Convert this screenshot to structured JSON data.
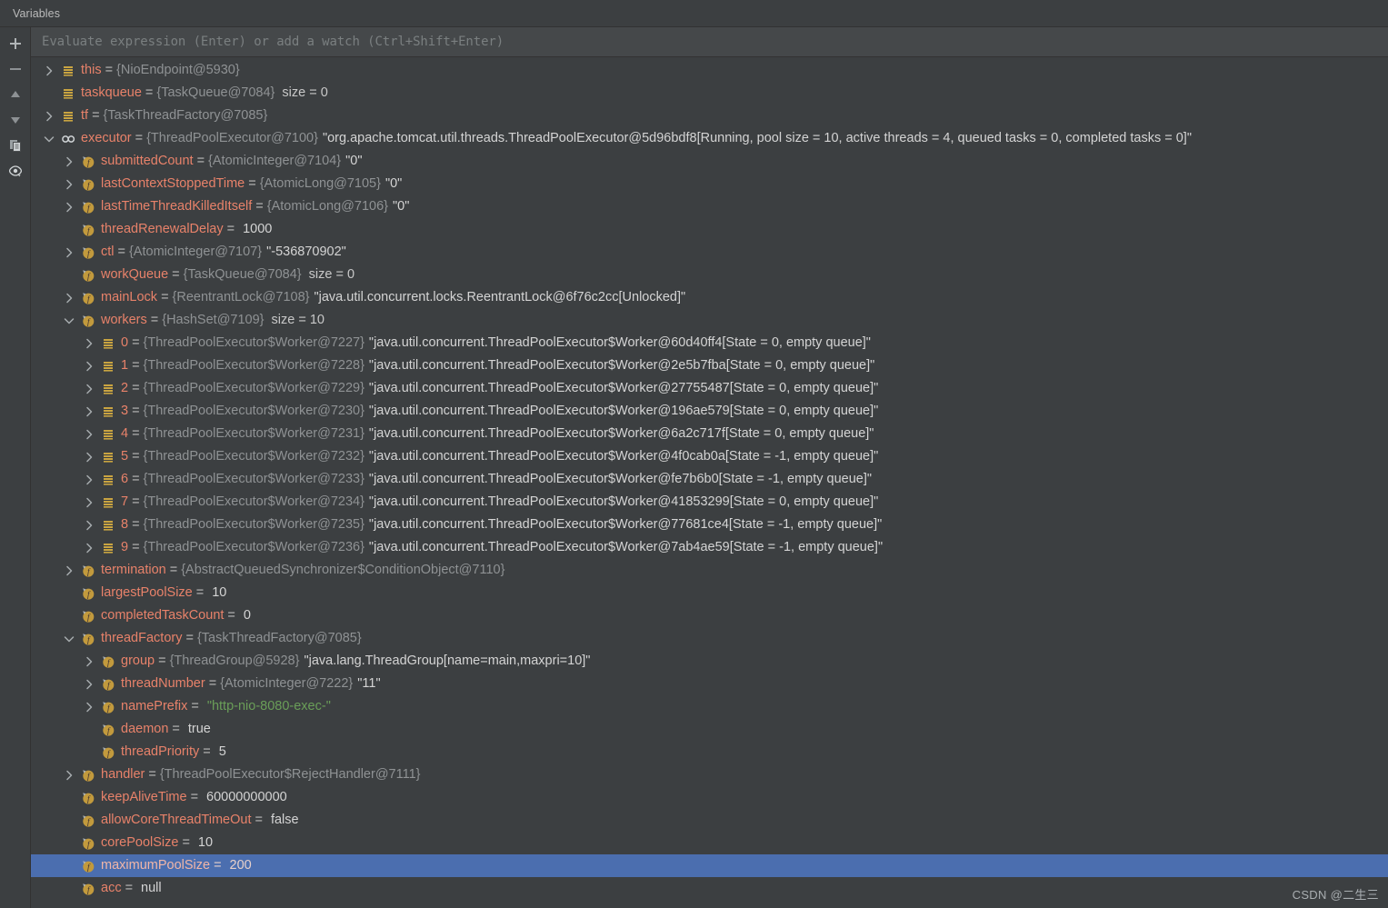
{
  "window": {
    "tab_label": "Variables"
  },
  "toolbar": {
    "buttons": [
      {
        "name": "add-watch-button",
        "icon": "plus-icon",
        "tooltip": "Add"
      },
      {
        "name": "remove-watch-button",
        "icon": "minus-icon",
        "tooltip": "Remove"
      },
      {
        "name": "move-up-button",
        "icon": "arrow-up-icon",
        "tooltip": "Up"
      },
      {
        "name": "move-down-button",
        "icon": "arrow-down-icon",
        "tooltip": "Down"
      },
      {
        "name": "copy-button",
        "icon": "copy-icon",
        "tooltip": "Copy"
      },
      {
        "name": "view-options-button",
        "icon": "eye-icon",
        "tooltip": "View Options"
      }
    ]
  },
  "evaluate": {
    "placeholder": "Evaluate expression (Enter) or add a watch (Ctrl+Shift+Enter)",
    "value": ""
  },
  "colors": {
    "background": "#3c3f41",
    "eval_background": "#45484a",
    "selection": "#4b6eaf",
    "name": "#e8826a",
    "type": "#8f9294",
    "value": "#d4d4d4",
    "string_literal": "#6a9e58",
    "icon_orange": "#c9a441"
  },
  "watermark": "CSDN @二生三",
  "tree": {
    "rows": [
      {
        "indent": 0,
        "twisty": "collapsed",
        "icon": "local-variable-icon",
        "name": "this",
        "eq": "=",
        "type": "{NioEndpoint@5930}",
        "value": "",
        "extra": ""
      },
      {
        "indent": 0,
        "twisty": "none",
        "icon": "local-variable-icon",
        "name": "taskqueue",
        "eq": "=",
        "type": "{TaskQueue@7084}",
        "value": "",
        "extra": "size = 0"
      },
      {
        "indent": 0,
        "twisty": "collapsed",
        "icon": "local-variable-icon",
        "name": "tf",
        "eq": "=",
        "type": "{TaskThreadFactory@7085}",
        "value": "",
        "extra": ""
      },
      {
        "indent": 0,
        "twisty": "expanded",
        "icon": "watch-icon",
        "name": "executor",
        "eq": "=",
        "type": "{ThreadPoolExecutor@7100}",
        "value": "\"org.apache.tomcat.util.threads.ThreadPoolExecutor@5d96bdf8[Running, pool size = 10, active threads = 4, queued tasks = 0, completed tasks = 0]\"",
        "extra": ""
      },
      {
        "indent": 1,
        "twisty": "collapsed",
        "icon": "field-icon",
        "name": "submittedCount",
        "eq": "=",
        "type": "{AtomicInteger@7104}",
        "value": "\"0\"",
        "extra": ""
      },
      {
        "indent": 1,
        "twisty": "collapsed",
        "icon": "field-icon",
        "name": "lastContextStoppedTime",
        "eq": "=",
        "type": "{AtomicLong@7105}",
        "value": "\"0\"",
        "extra": ""
      },
      {
        "indent": 1,
        "twisty": "collapsed",
        "icon": "field-icon",
        "name": "lastTimeThreadKilledItself",
        "eq": "=",
        "type": "{AtomicLong@7106}",
        "value": "\"0\"",
        "extra": ""
      },
      {
        "indent": 1,
        "twisty": "none",
        "icon": "field-icon",
        "name": "threadRenewalDelay",
        "eq": "=",
        "type": "",
        "value": "1000",
        "extra": ""
      },
      {
        "indent": 1,
        "twisty": "collapsed",
        "icon": "field-icon",
        "name": "ctl",
        "eq": "=",
        "type": "{AtomicInteger@7107}",
        "value": "\"-536870902\"",
        "extra": ""
      },
      {
        "indent": 1,
        "twisty": "none",
        "icon": "field-icon",
        "name": "workQueue",
        "eq": "=",
        "type": "{TaskQueue@7084}",
        "value": "",
        "extra": "size = 0"
      },
      {
        "indent": 1,
        "twisty": "collapsed",
        "icon": "field-icon",
        "name": "mainLock",
        "eq": "=",
        "type": "{ReentrantLock@7108}",
        "value": "\"java.util.concurrent.locks.ReentrantLock@6f76c2cc[Unlocked]\"",
        "extra": ""
      },
      {
        "indent": 1,
        "twisty": "expanded",
        "icon": "field-icon",
        "name": "workers",
        "eq": "=",
        "type": "{HashSet@7109}",
        "value": "",
        "extra": "size = 10"
      },
      {
        "indent": 2,
        "twisty": "collapsed",
        "icon": "local-variable-icon",
        "name": "0",
        "eq": "=",
        "type": "{ThreadPoolExecutor$Worker@7227}",
        "value": "\"java.util.concurrent.ThreadPoolExecutor$Worker@60d40ff4[State = 0, empty queue]\"",
        "extra": ""
      },
      {
        "indent": 2,
        "twisty": "collapsed",
        "icon": "local-variable-icon",
        "name": "1",
        "eq": "=",
        "type": "{ThreadPoolExecutor$Worker@7228}",
        "value": "\"java.util.concurrent.ThreadPoolExecutor$Worker@2e5b7fba[State = 0, empty queue]\"",
        "extra": ""
      },
      {
        "indent": 2,
        "twisty": "collapsed",
        "icon": "local-variable-icon",
        "name": "2",
        "eq": "=",
        "type": "{ThreadPoolExecutor$Worker@7229}",
        "value": "\"java.util.concurrent.ThreadPoolExecutor$Worker@27755487[State = 0, empty queue]\"",
        "extra": ""
      },
      {
        "indent": 2,
        "twisty": "collapsed",
        "icon": "local-variable-icon",
        "name": "3",
        "eq": "=",
        "type": "{ThreadPoolExecutor$Worker@7230}",
        "value": "\"java.util.concurrent.ThreadPoolExecutor$Worker@196ae579[State = 0, empty queue]\"",
        "extra": ""
      },
      {
        "indent": 2,
        "twisty": "collapsed",
        "icon": "local-variable-icon",
        "name": "4",
        "eq": "=",
        "type": "{ThreadPoolExecutor$Worker@7231}",
        "value": "\"java.util.concurrent.ThreadPoolExecutor$Worker@6a2c717f[State = 0, empty queue]\"",
        "extra": ""
      },
      {
        "indent": 2,
        "twisty": "collapsed",
        "icon": "local-variable-icon",
        "name": "5",
        "eq": "=",
        "type": "{ThreadPoolExecutor$Worker@7232}",
        "value": "\"java.util.concurrent.ThreadPoolExecutor$Worker@4f0cab0a[State = -1, empty queue]\"",
        "extra": ""
      },
      {
        "indent": 2,
        "twisty": "collapsed",
        "icon": "local-variable-icon",
        "name": "6",
        "eq": "=",
        "type": "{ThreadPoolExecutor$Worker@7233}",
        "value": "\"java.util.concurrent.ThreadPoolExecutor$Worker@fe7b6b0[State = -1, empty queue]\"",
        "extra": ""
      },
      {
        "indent": 2,
        "twisty": "collapsed",
        "icon": "local-variable-icon",
        "name": "7",
        "eq": "=",
        "type": "{ThreadPoolExecutor$Worker@7234}",
        "value": "\"java.util.concurrent.ThreadPoolExecutor$Worker@41853299[State = 0, empty queue]\"",
        "extra": ""
      },
      {
        "indent": 2,
        "twisty": "collapsed",
        "icon": "local-variable-icon",
        "name": "8",
        "eq": "=",
        "type": "{ThreadPoolExecutor$Worker@7235}",
        "value": "\"java.util.concurrent.ThreadPoolExecutor$Worker@77681ce4[State = -1, empty queue]\"",
        "extra": ""
      },
      {
        "indent": 2,
        "twisty": "collapsed",
        "icon": "local-variable-icon",
        "name": "9",
        "eq": "=",
        "type": "{ThreadPoolExecutor$Worker@7236}",
        "value": "\"java.util.concurrent.ThreadPoolExecutor$Worker@7ab4ae59[State = -1, empty queue]\"",
        "extra": ""
      },
      {
        "indent": 1,
        "twisty": "collapsed",
        "icon": "field-icon",
        "name": "termination",
        "eq": "=",
        "type": "{AbstractQueuedSynchronizer$ConditionObject@7110}",
        "value": "",
        "extra": ""
      },
      {
        "indent": 1,
        "twisty": "none",
        "icon": "field-icon",
        "name": "largestPoolSize",
        "eq": "=",
        "type": "",
        "value": "10",
        "extra": ""
      },
      {
        "indent": 1,
        "twisty": "none",
        "icon": "field-icon",
        "name": "completedTaskCount",
        "eq": "=",
        "type": "",
        "value": "0",
        "extra": ""
      },
      {
        "indent": 1,
        "twisty": "expanded",
        "icon": "field-icon",
        "name": "threadFactory",
        "eq": "=",
        "type": "{TaskThreadFactory@7085}",
        "value": "",
        "extra": ""
      },
      {
        "indent": 2,
        "twisty": "collapsed",
        "icon": "field-icon",
        "name": "group",
        "eq": "=",
        "type": "{ThreadGroup@5928}",
        "value": "\"java.lang.ThreadGroup[name=main,maxpri=10]\"",
        "extra": ""
      },
      {
        "indent": 2,
        "twisty": "collapsed",
        "icon": "field-icon",
        "name": "threadNumber",
        "eq": "=",
        "type": "{AtomicInteger@7222}",
        "value": "\"11\"",
        "extra": ""
      },
      {
        "indent": 2,
        "twisty": "collapsed",
        "icon": "field-icon",
        "name": "namePrefix",
        "eq": "=",
        "type": "",
        "value": "\"http-nio-8080-exec-\"",
        "value_is_string": true,
        "extra": ""
      },
      {
        "indent": 2,
        "twisty": "none",
        "icon": "field-icon",
        "name": "daemon",
        "eq": "=",
        "type": "",
        "value": "true",
        "extra": ""
      },
      {
        "indent": 2,
        "twisty": "none",
        "icon": "field-icon",
        "name": "threadPriority",
        "eq": "=",
        "type": "",
        "value": "5",
        "extra": ""
      },
      {
        "indent": 1,
        "twisty": "collapsed",
        "icon": "field-icon",
        "name": "handler",
        "eq": "=",
        "type": "{ThreadPoolExecutor$RejectHandler@7111}",
        "value": "",
        "extra": ""
      },
      {
        "indent": 1,
        "twisty": "none",
        "icon": "field-icon",
        "name": "keepAliveTime",
        "eq": "=",
        "type": "",
        "value": "60000000000",
        "extra": ""
      },
      {
        "indent": 1,
        "twisty": "none",
        "icon": "field-icon",
        "name": "allowCoreThreadTimeOut",
        "eq": "=",
        "type": "",
        "value": "false",
        "extra": ""
      },
      {
        "indent": 1,
        "twisty": "none",
        "icon": "field-icon",
        "name": "corePoolSize",
        "eq": "=",
        "type": "",
        "value": "10",
        "extra": ""
      },
      {
        "indent": 1,
        "twisty": "none",
        "icon": "field-icon",
        "name": "maximumPoolSize",
        "eq": "=",
        "type": "",
        "value": "200",
        "extra": "",
        "selected": true
      },
      {
        "indent": 1,
        "twisty": "none",
        "icon": "field-icon",
        "name": "acc",
        "eq": "=",
        "type": "",
        "value": "null",
        "extra": ""
      }
    ]
  }
}
